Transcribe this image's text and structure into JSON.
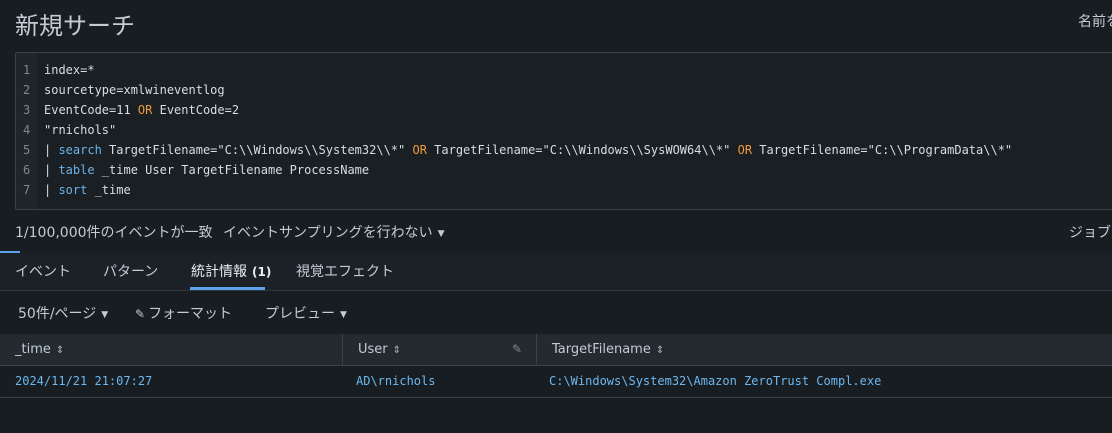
{
  "page": {
    "title": "新規サーチ",
    "name_save_label": "名前を"
  },
  "search": {
    "lines": [
      {
        "num": "1",
        "parts": [
          {
            "t": "index=*",
            "c": "plain"
          }
        ]
      },
      {
        "num": "2",
        "parts": [
          {
            "t": "sourcetype=xmlwineventlog",
            "c": "plain"
          }
        ]
      },
      {
        "num": "3",
        "parts": [
          {
            "t": "EventCode=11 ",
            "c": "plain"
          },
          {
            "t": "OR",
            "c": "op"
          },
          {
            "t": " EventCode=2",
            "c": "plain"
          }
        ]
      },
      {
        "num": "4",
        "parts": [
          {
            "t": "\"rnichols\"",
            "c": "plain"
          }
        ]
      },
      {
        "num": "5",
        "parts": [
          {
            "t": "| ",
            "c": "plain"
          },
          {
            "t": "search",
            "c": "kw"
          },
          {
            "t": " TargetFilename=\"C:\\\\Windows\\\\System32\\\\*\" ",
            "c": "plain"
          },
          {
            "t": "OR",
            "c": "op"
          },
          {
            "t": " TargetFilename=\"C:\\\\Windows\\\\SysWOW64\\\\*\" ",
            "c": "plain"
          },
          {
            "t": "OR",
            "c": "op"
          },
          {
            "t": " TargetFilename=\"C:\\\\ProgramData\\\\*\"",
            "c": "plain"
          }
        ]
      },
      {
        "num": "6",
        "parts": [
          {
            "t": "| ",
            "c": "plain"
          },
          {
            "t": "table",
            "c": "kw"
          },
          {
            "t": " _time User TargetFilename ProcessName",
            "c": "plain"
          }
        ]
      },
      {
        "num": "7",
        "parts": [
          {
            "t": "| ",
            "c": "plain"
          },
          {
            "t": "sort",
            "c": "kw"
          },
          {
            "t": " _time",
            "c": "plain"
          }
        ]
      }
    ]
  },
  "status": {
    "event_count": "1/100,000件のイベントが一致",
    "sampling": "イベントサンプリングを行わない",
    "job": "ジョブ"
  },
  "tabs": {
    "events": "イベント",
    "patterns": "パターン",
    "statistics": "統計情報",
    "statistics_count": "(1)",
    "visualization": "視覚エフェクト"
  },
  "toolbar": {
    "per_page": "50件/ページ",
    "format": "フォーマット",
    "preview": "プレビュー"
  },
  "table": {
    "columns": [
      "_time",
      "User",
      "TargetFilename"
    ],
    "rows": [
      [
        "2024/11/21 21:07:27",
        "AD\\rnichols",
        "C:\\Windows\\System32\\Amazon ZeroTrust Compl.exe"
      ]
    ]
  },
  "colors": {
    "background": "#171d21",
    "accent": "#5ca3ec",
    "keyword": "#6bb2e8",
    "operator": "#ee9a3e",
    "link": "#6db7f0"
  }
}
